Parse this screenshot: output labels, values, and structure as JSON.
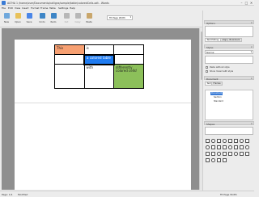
{
  "window": {
    "title": "ALTHA 1 /home/user/Documents/calligra/sample/table/coloredCells.odt - Words",
    "minimize": "–",
    "maximize": "□",
    "close": "✕"
  },
  "menu": [
    "File",
    "Edit",
    "View",
    "Insert",
    "Format",
    "Frame",
    "Table",
    "Settings",
    "Help"
  ],
  "toolbar": {
    "buttons": [
      {
        "label": "New",
        "icon": "new-document-icon",
        "color": "#6fa8dc"
      },
      {
        "label": "Open",
        "icon": "open-folder-icon",
        "color": "#e8c15a"
      },
      {
        "label": "Save",
        "icon": "save-icon",
        "color": "#4a86e8"
      },
      {
        "label": "Undo",
        "icon": "undo-icon",
        "color": "#3d85c6"
      },
      {
        "label": "Redo",
        "icon": "redo-icon",
        "color": "#3d85c6"
      },
      {
        "label": "Cut",
        "icon": "cut-icon",
        "color": "#b7b7b7"
      },
      {
        "label": "Copy",
        "icon": "copy-icon",
        "color": "#b7b7b7"
      },
      {
        "label": "Paste",
        "icon": "paste-icon",
        "color": "#c9a66b"
      }
    ],
    "zoom": "Fit Page Width"
  },
  "document": {
    "table": [
      [
        {
          "text": "This",
          "style": "orange"
        },
        {
          "text": "is",
          "style": ""
        },
        {
          "text": "",
          "style": ""
        }
      ],
      [
        {
          "text": "",
          "style": ""
        },
        {
          "text": "a colored table",
          "style": "blue"
        },
        {
          "text": "",
          "style": ""
        }
      ],
      [
        {
          "text": "",
          "style": ""
        },
        {
          "text": "with",
          "style": ""
        },
        {
          "text": "differently colored cells!",
          "style": "green"
        }
      ]
    ]
  },
  "dock": {
    "tool_options": {
      "title": "Options",
      "tabs": [
        "Text Editing",
        "Align",
        "Bookmark"
      ]
    },
    "styles": {
      "title": "Styles",
      "style_value": "Normal",
      "checks": [
        "Paste without style",
        "Show mixed with style"
      ]
    },
    "docker": {
      "title": "Document",
      "tabs": [
        "Text",
        "Frames"
      ],
      "items": [
        "Document",
        "Section",
        "Standard"
      ]
    },
    "shapes": {
      "title": "Shapes"
    }
  },
  "status": {
    "page": "Page: 1/1",
    "modified": "Modified",
    "zoom": "Fit Page Width"
  }
}
